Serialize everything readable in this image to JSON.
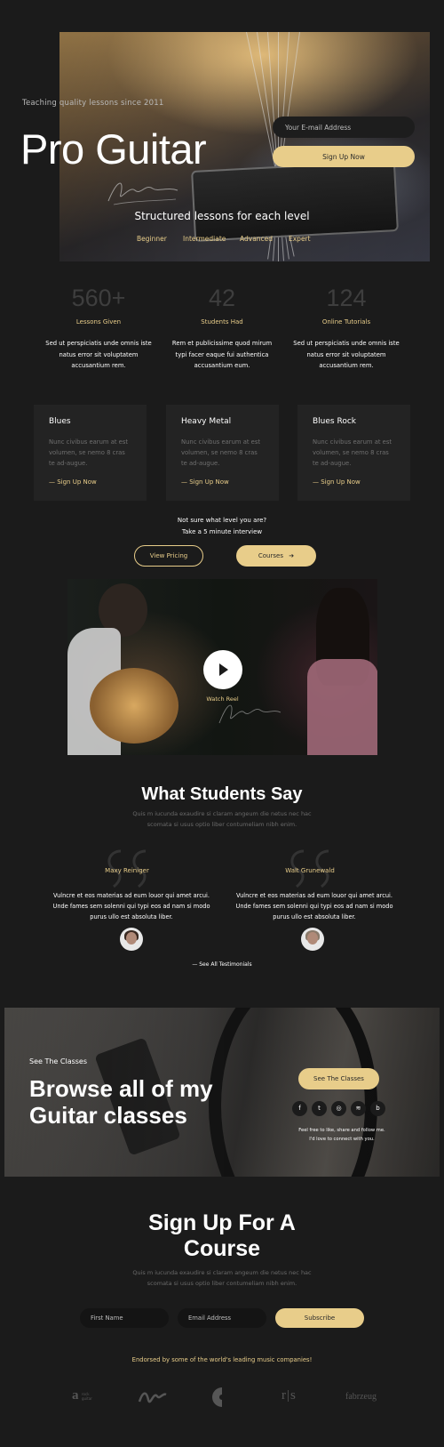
{
  "hero": {
    "tagline": "Teaching quality lessons since 2011",
    "title": "Pro Guitar",
    "email_placeholder": "Your E-mail Address",
    "signup_label": "Sign Up Now",
    "subtitle": "Structured lessons for each level",
    "levels": [
      "Beginner",
      "Intermediate",
      "Advanced",
      "Expert"
    ]
  },
  "stats": [
    {
      "number": "560+",
      "label": "Lessons Given",
      "text": "Sed ut perspiciatis unde omnis iste natus error sit voluptatem accusantium rem."
    },
    {
      "number": "42",
      "label": "Students Had",
      "text": "Rem et publicissime quod mirum typi facer eaque fui authentica accusantium eum."
    },
    {
      "number": "124",
      "label": "Online Tutorials",
      "text": "Sed ut perspiciatis unde omnis iste natus error sit voluptatem accusantium rem."
    }
  ],
  "cards": [
    {
      "title": "Blues",
      "desc": "Nunc civibus earum at est volumen, se nemo 8 cras te ad-augue.",
      "link": "— Sign Up Now"
    },
    {
      "title": "Heavy Metal",
      "desc": "Nunc civibus earum at est volumen, se nemo 8 cras te ad-augue.",
      "link": "— Sign Up Now"
    },
    {
      "title": "Blues Rock",
      "desc": "Nunc civibus earum at est volumen, se nemo 8 cras te ad-augue.",
      "link": "— Sign Up Now"
    }
  ],
  "level_prompt": {
    "line1": "Not sure what level you are?",
    "line2": "Take a 5 minute interview",
    "pricing_label": "View Pricing",
    "courses_label": "Courses",
    "courses_arrow": "➔"
  },
  "video": {
    "watch_label": "Watch Reel",
    "play_icon": "play-icon"
  },
  "testimonials": {
    "title": "What Students Say",
    "subtitle_line1": "Quis m iucunda exaudire si claram angeum die netus nec hac",
    "subtitle_line2": "scomata si usus optio liber contumeliam nibh enim.",
    "items": [
      {
        "name": "Maxy Reiniger",
        "text": "Vulncre et eos materias ad eum louor qui amet arcui. Unde fames sem solenni qui typi eos ad nam si modo purus ullo est absoluta liber."
      },
      {
        "name": "Walt Grunewald",
        "text": "Vulncre et eos materias ad eum louor qui amet arcui. Unde fames sem solenni qui typi eos ad nam si modo purus ullo est absoluta liber."
      }
    ],
    "see_all": "— See All Testimonials"
  },
  "browse": {
    "kicker": "See The Classes",
    "title": "Browse all of my Guitar classes",
    "button": "See The Classes",
    "social": [
      {
        "icon": "facebook-icon",
        "glyph": "f"
      },
      {
        "icon": "twitter-icon",
        "glyph": "t"
      },
      {
        "icon": "instagram-icon",
        "glyph": "◎"
      },
      {
        "icon": "spotify-icon",
        "glyph": "≋"
      },
      {
        "icon": "bandcamp-icon",
        "glyph": "b"
      }
    ],
    "share_line1": "Feel free to like, share and follow me.",
    "share_line2": "I'd love to connect with you."
  },
  "signup": {
    "title_line1": "Sign Up For A",
    "title_line2": "Course",
    "subtitle_line1": "Quis m iucunda exaudire si claram angeum die netus nec hac",
    "subtitle_line2": "scomata si usus optio liber contumeliam nibh enim.",
    "first_name_placeholder": "First Name",
    "email_placeholder": "Email Address",
    "subscribe_label": "Subscribe"
  },
  "endorse": {
    "text": "Endorsed by some of the world's leading music companies!",
    "logos": [
      "a",
      "∿∿",
      "C",
      "r|s",
      "fabrzeug"
    ],
    "logo1_caption": "rock guitar"
  },
  "colors": {
    "accent": "#e8cd8a",
    "background": "#1b1b1b",
    "card": "#232323"
  }
}
